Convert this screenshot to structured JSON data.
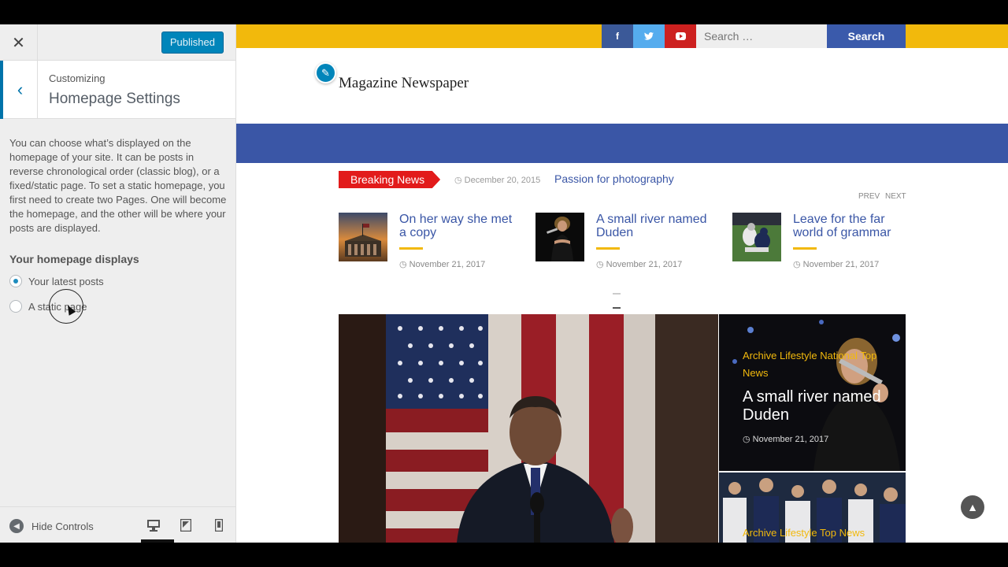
{
  "panel": {
    "close_label": "✕",
    "publish_label": "Published",
    "back_label": "‹",
    "breadcrumb": "Customizing",
    "section_title": "Homepage Settings",
    "description": "You can choose what’s displayed on the homepage of your site. It can be posts in reverse chronological order (classic blog), or a fixed/static page. To set a static homepage, you first need to create two Pages. One will become the homepage, and the other will be where your posts are displayed.",
    "option_heading": "Your homepage displays",
    "options": [
      {
        "label": "Your latest posts",
        "selected": true
      },
      {
        "label": "A static page",
        "selected": false
      }
    ],
    "hide_controls_label": "Hide Controls",
    "devices": [
      "desktop-icon",
      "tablet-icon",
      "mobile-icon"
    ],
    "accent_color": "#0073aa"
  },
  "site": {
    "social": [
      "facebook-icon",
      "twitter-icon",
      "youtube-icon"
    ],
    "search_placeholder": "Search …",
    "search_button": "Search",
    "logo_text": "Magazine Newspaper",
    "breaking_label": "Breaking News",
    "breaking_date": "December 20, 2015",
    "breaking_title": "Passion for photography",
    "prev_label": "PREV",
    "next_label": "NEXT",
    "cards": [
      {
        "title": "On her way she met a copy",
        "date": "November 21, 2017"
      },
      {
        "title": "A small river named Duden",
        "date": "November 21, 2017"
      },
      {
        "title": "Leave for the far world of grammar",
        "date": "November 21, 2017"
      }
    ],
    "hero_side1": {
      "categories": "Archive Lifestyle National Top News",
      "title": "A small river named Duden",
      "date": "November 21, 2017"
    },
    "hero_side2": {
      "categories": "Archive Lifestyle Top News"
    },
    "colors": {
      "topbar": "#f2b90c",
      "nav": "#3a56a6",
      "breaking": "#e21b1b",
      "link": "#3a56a6"
    }
  }
}
